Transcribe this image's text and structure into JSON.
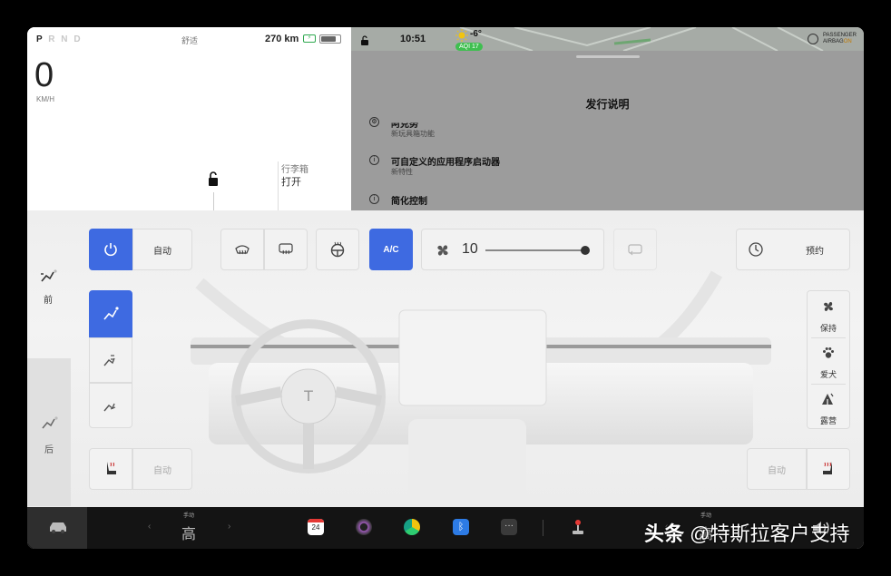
{
  "drive": {
    "gears": [
      "P",
      "R",
      "N",
      "D"
    ],
    "active_gear": "P",
    "mode": "舒适",
    "range": "270 km",
    "battery_level": 0.82,
    "speed": "0",
    "speed_unit": "KM/H",
    "trunk_label": "行李箱",
    "trunk_action": "打开"
  },
  "status": {
    "time": "10:51",
    "temperature": "-6°",
    "aqi": "AQI 17",
    "airbag_line1": "PASSENGER",
    "airbag_line2": "AIRBAG",
    "airbag_state": "ON"
  },
  "release_notes": {
    "title": "发行说明",
    "items": [
      {
        "title": "可自定义的应用程序启动器",
        "subtitle": "新特性"
      },
      {
        "title": "简化控制",
        "subtitle": ""
      }
    ],
    "partial_item": {
      "title": "阿克努",
      "subtitle": "新玩具箱功能"
    }
  },
  "climate": {
    "auto_label": "自动",
    "ac_label": "A/C",
    "fan_speed": "10",
    "fan_level": 1.0,
    "schedule_label": "预约",
    "front_label": "前",
    "rear_label": "后",
    "seat_left_auto": "自动",
    "seat_right_auto": "自动",
    "right_modes": [
      "保持",
      "爱犬",
      "露营"
    ],
    "accent_color": "#3e6ae1"
  },
  "taskbar": {
    "left_temp_mode": "手动",
    "left_temp": "高",
    "right_temp_mode": "手动",
    "right_temp": "高",
    "calendar_day": "24",
    "watermark_prefix": "头条",
    "watermark_handle": "@特斯拉客户支持"
  }
}
